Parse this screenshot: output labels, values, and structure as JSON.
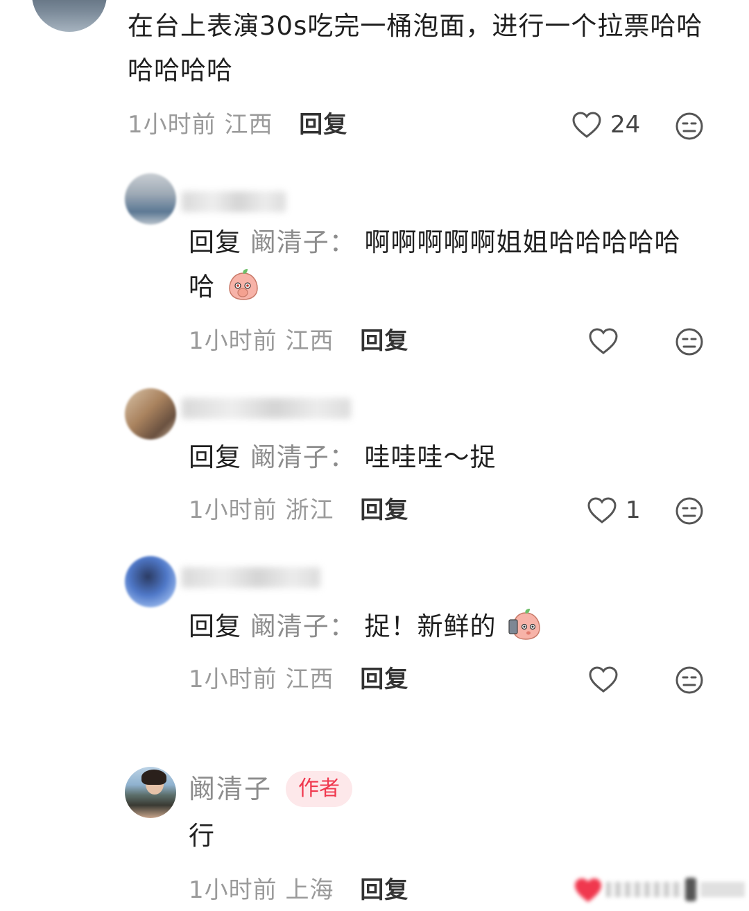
{
  "comment_main": {
    "text": "在台上表演30s吃完一桶泡面，进行一个拉票哈哈哈哈哈哈",
    "time": "1小时前",
    "location": "江西",
    "reply_label": "回复",
    "likes": "24"
  },
  "replies": [
    {
      "reply_keyword": "回复",
      "reply_to": "阚清子：",
      "text": "啊啊啊啊啊姐姐哈哈哈哈哈哈",
      "emoji": "peach-blush-emoji",
      "time": "1小时前",
      "location": "江西",
      "reply_label": "回复",
      "likes": ""
    },
    {
      "reply_keyword": "回复",
      "reply_to": "阚清子：",
      "text": "哇哇哇～捉",
      "time": "1小时前",
      "location": "浙江",
      "reply_label": "回复",
      "likes": "1"
    },
    {
      "reply_keyword": "回复",
      "reply_to": "阚清子：",
      "text": "捉！新鲜的",
      "emoji": "peach-selfie-emoji",
      "time": "1小时前",
      "location": "江西",
      "reply_label": "回复",
      "likes": ""
    }
  ],
  "author_comment": {
    "name": "阚清子",
    "badge": "作者",
    "text": "行",
    "time": "1小时前",
    "location": "上海",
    "reply_label": "回复"
  },
  "colors": {
    "text_primary": "#1f1f1f",
    "text_secondary": "#9a9a9a",
    "author_badge_bg": "#fde8ea",
    "author_badge_text": "#f0384e",
    "like_red": "#f0384e"
  },
  "icons": [
    "heart-outline-icon",
    "dislike-face-icon",
    "heart-filled-icon"
  ]
}
